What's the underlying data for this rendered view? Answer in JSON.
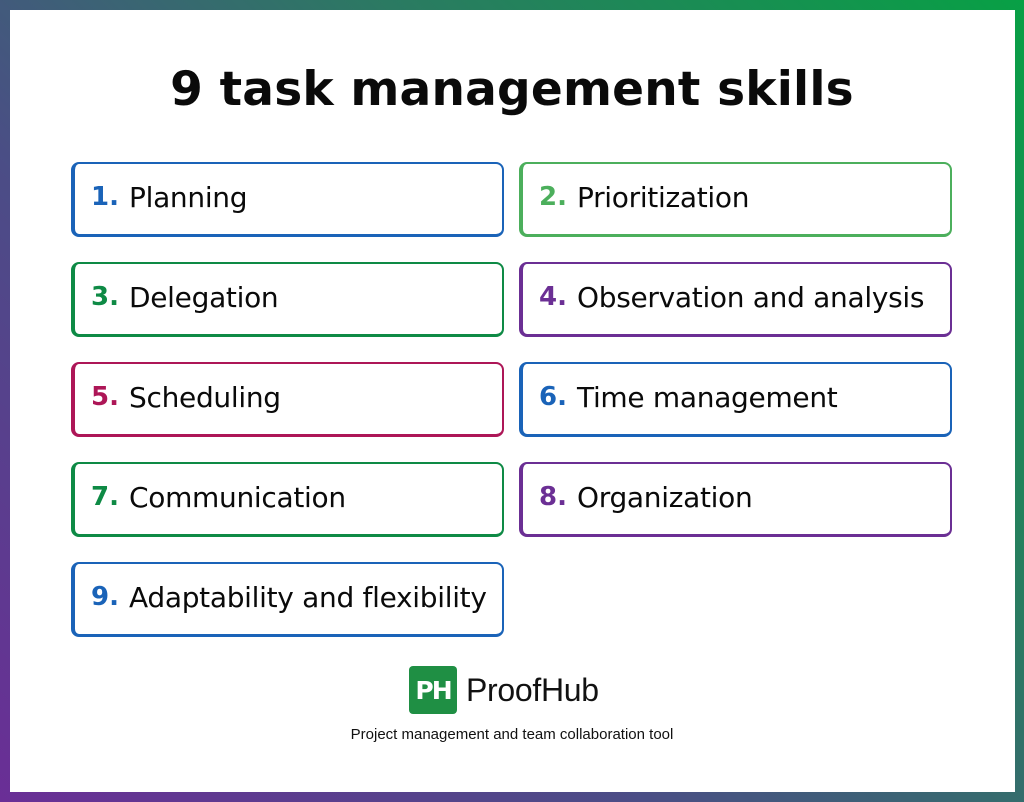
{
  "title": "9 task management skills",
  "skills": [
    {
      "number": "1.",
      "label": "Planning",
      "color": "#1a63b8"
    },
    {
      "number": "2.",
      "label": "Prioritization",
      "color": "#4caf5c"
    },
    {
      "number": "3.",
      "label": "Delegation",
      "color": "#0e8a45"
    },
    {
      "number": "4.",
      "label": "Observation and analysis",
      "color": "#6b2f94"
    },
    {
      "number": "5.",
      "label": "Scheduling",
      "color": "#ad1657"
    },
    {
      "number": "6.",
      "label": "Time management",
      "color": "#1a63b8"
    },
    {
      "number": "7.",
      "label": "Communication",
      "color": "#0e8a45"
    },
    {
      "number": "8.",
      "label": "Organization",
      "color": "#6b2f94"
    },
    {
      "number": "9.",
      "label": "Adaptability and flexibility",
      "color": "#1a63b8"
    }
  ],
  "brand": {
    "logo_mark": "PH",
    "name": "ProofHub",
    "tagline": "Project management and team collaboration tool",
    "color": "#1f8f44"
  }
}
